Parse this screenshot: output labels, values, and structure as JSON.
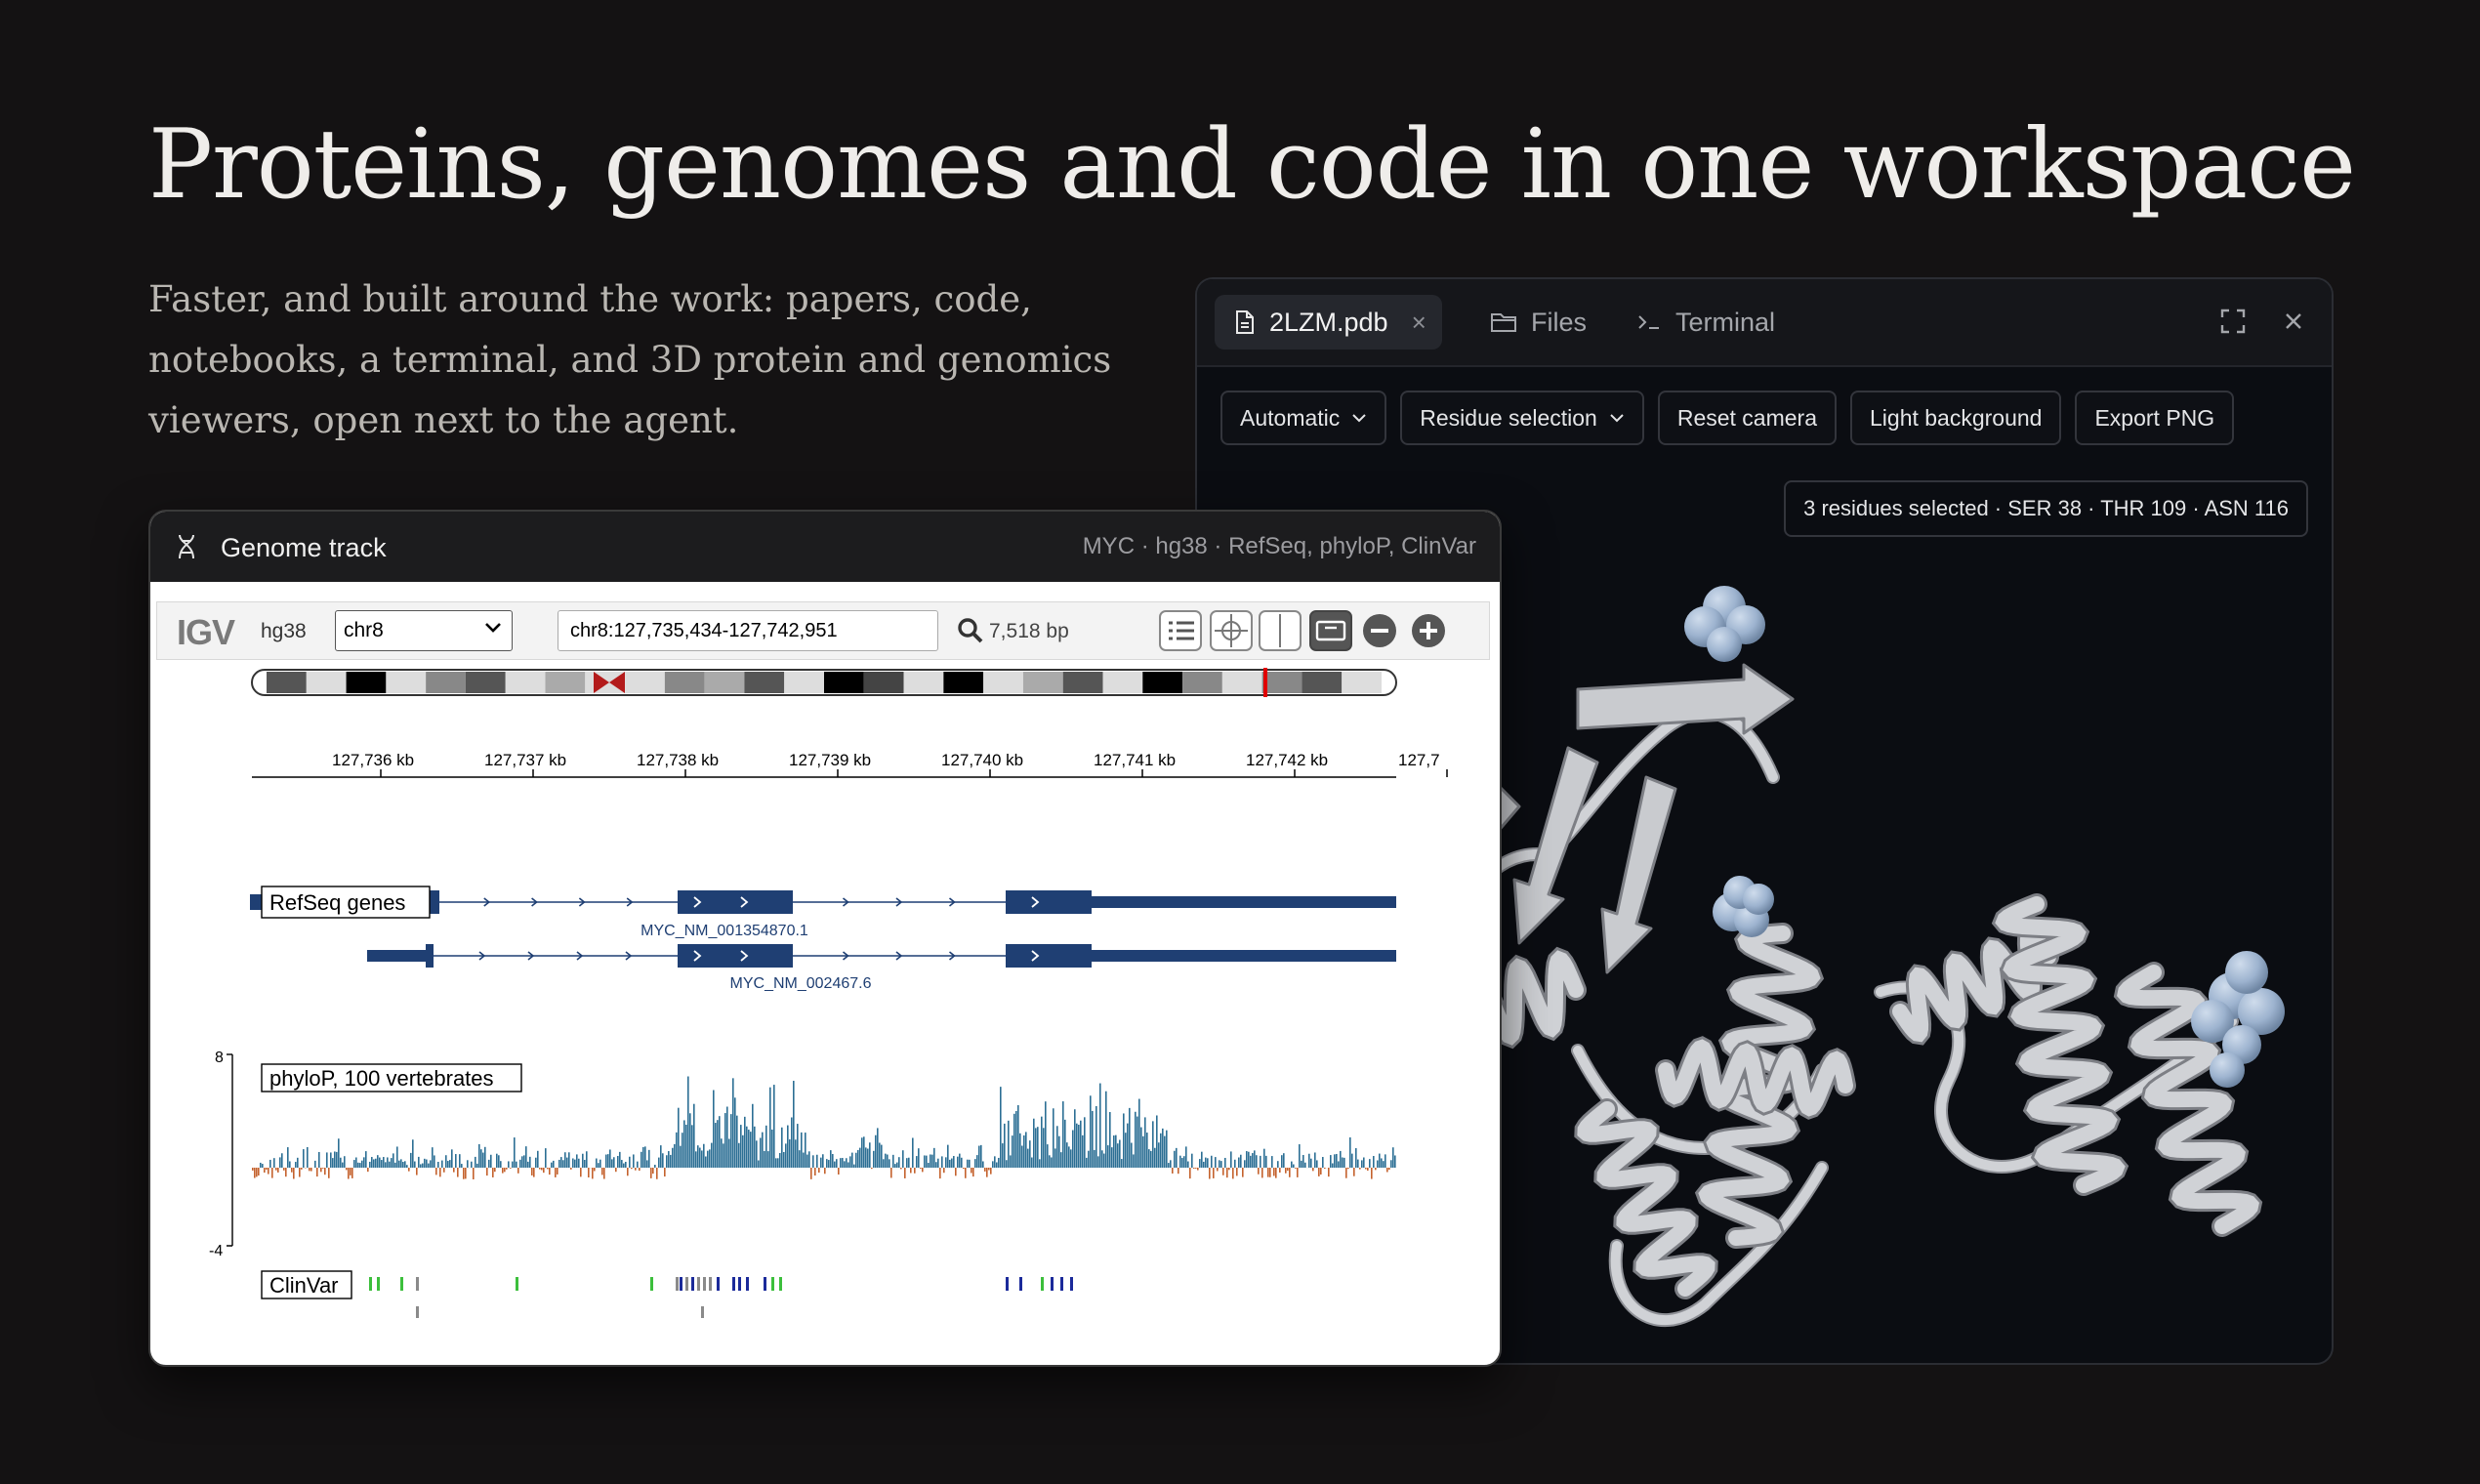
{
  "hero": {
    "title": "Proteins, genomes and code in one workspace",
    "subtitle": "Faster, and built around the work: papers, code, notebooks, a terminal, and 3D protein and genomics viewers, open next to the agent."
  },
  "viewer": {
    "tabs": [
      {
        "label": "2LZM.pdb",
        "icon": "file-icon",
        "active": true,
        "closable": true
      },
      {
        "label": "Files",
        "icon": "folder-icon",
        "active": false
      },
      {
        "label": "Terminal",
        "icon": "terminal-icon",
        "active": false
      }
    ],
    "close_glyph": "×",
    "window_icons": [
      "expand-icon",
      "close-icon"
    ],
    "toolbar": {
      "automatic": "Automatic",
      "residue_selection": "Residue selection",
      "reset_camera": "Reset camera",
      "light_background": "Light background",
      "export_png": "Export PNG"
    },
    "selection_status": "3 residues selected · SER 38 · THR 109 · ASN 116",
    "colors": {
      "ribbon": "#d0d2d6",
      "selected_atoms": "#9db3cf",
      "background": "#0b0d12"
    }
  },
  "genome": {
    "title": "Genome track",
    "meta": "MYC · hg38 · RefSeq, phyloP, ClinVar",
    "igv": {
      "logo": "IGV",
      "genome": "hg38",
      "chromosome": "chr8",
      "locus": "chr8:127,735,434-127,742,951",
      "width_bp": "7,518 bp"
    },
    "ruler_ticks": [
      "127,736 kb",
      "127,737 kb",
      "127,738 kb",
      "127,739 kb",
      "127,740 kb",
      "127,741 kb",
      "127,742 kb",
      "127,7"
    ],
    "tracks": {
      "refseq": {
        "label": "RefSeq genes",
        "transcripts": [
          "MYC_NM_001354870.1",
          "MYC_NM_002467.6"
        ]
      },
      "phylop": {
        "label": "phyloP, 100 vertebrates",
        "max": "8",
        "min": "-4"
      },
      "clinvar": {
        "label": "ClinVar"
      }
    },
    "colors": {
      "gene": "#1f3f73",
      "phylop_pos": "#2c6f94",
      "phylop_neg": "#c4622d",
      "clinvar_benign": "#3cbf3c",
      "clinvar_uncertain": "#8a8a8a",
      "clinvar_pathogenic": "#1b2a9a"
    }
  }
}
